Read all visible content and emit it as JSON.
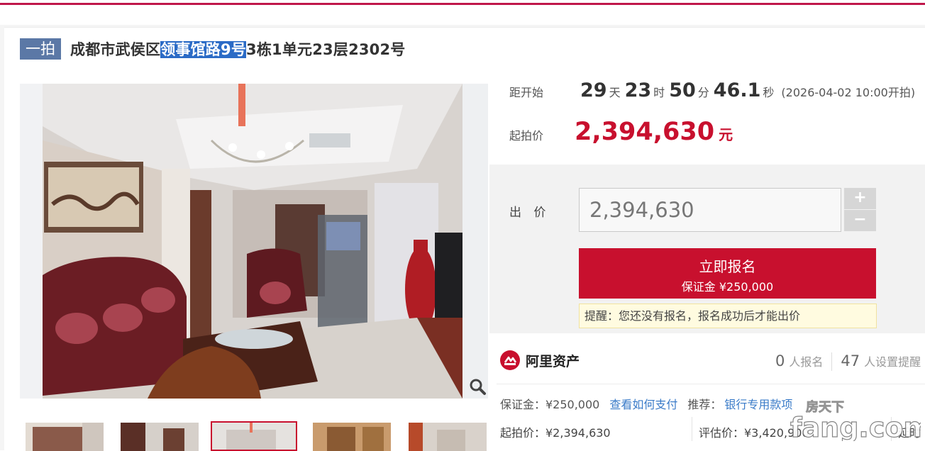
{
  "header": {
    "badge": "一拍",
    "title_prefix": "成都市武侯区",
    "title_highlight": "领事馆路9号",
    "title_suffix": "3栋1单元23层2302号"
  },
  "countdown": {
    "label": "距开始",
    "days": "29",
    "days_unit": "天",
    "hours": "23",
    "hours_unit": "时",
    "minutes": "50",
    "minutes_unit": "分",
    "seconds": "46.1",
    "seconds_unit": "秒",
    "start_text": "(2026-04-02 10:00开拍)"
  },
  "start_price": {
    "label": "起拍价",
    "value": "2,394,630",
    "unit": "元"
  },
  "bid": {
    "label": "出 价",
    "input_value": "2,394,630",
    "plus": "+",
    "minus": "−",
    "signup_label": "立即报名",
    "deposit_label": "保证金 ¥250,000",
    "tip": "提醒：您还没有报名，报名成功后才能出价"
  },
  "platform": {
    "name": "阿里资产",
    "signups_num": "0",
    "signups_text": "人报名",
    "reminders_num": "47",
    "reminders_text": "人设置提醒"
  },
  "info": {
    "deposit_label": "保证金：¥250,000",
    "how_to_pay": "查看如何支付",
    "recommend_label": "推荐：",
    "recommend_link": "银行专用款项",
    "start_price_label": "起拍价：¥2,394,630",
    "eval_label": "评估价：¥3,420,900",
    "delay_label": "延时"
  },
  "watermark": {
    "line1": "房天下",
    "line2": "fang.com"
  },
  "colors": {
    "accent": "#c8102e",
    "badge": "#5b78a6",
    "link": "#3a7bc8",
    "highlight": "#2b6bc6"
  },
  "icons": [
    "zoom-icon",
    "alibaba-assets-logo-icon"
  ]
}
